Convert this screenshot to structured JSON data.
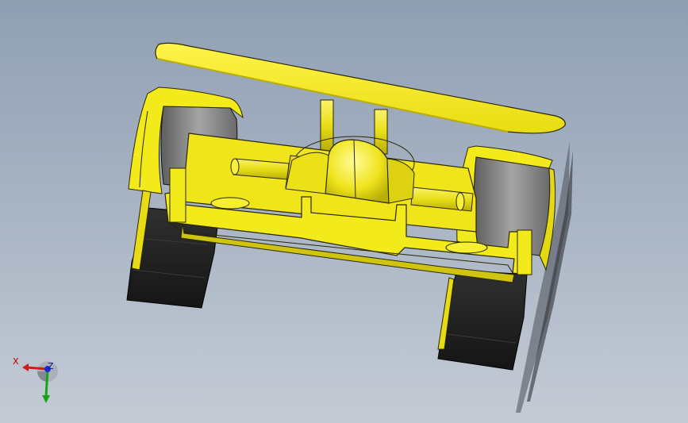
{
  "viewport": {
    "background_top": "#8f9fb3",
    "background_bottom": "#c4cbd5"
  },
  "model": {
    "body_color": "#f2ea1a",
    "edge_color": "#1a1a00",
    "tire_tread_color": "#1e1e1e",
    "wheel_face_color": "#8a8a8a"
  },
  "triad": {
    "x_label": "X",
    "z_label": "Z",
    "x_color": "#d11a1a",
    "y_color": "#16a316",
    "z_color": "#1a2ad1"
  }
}
